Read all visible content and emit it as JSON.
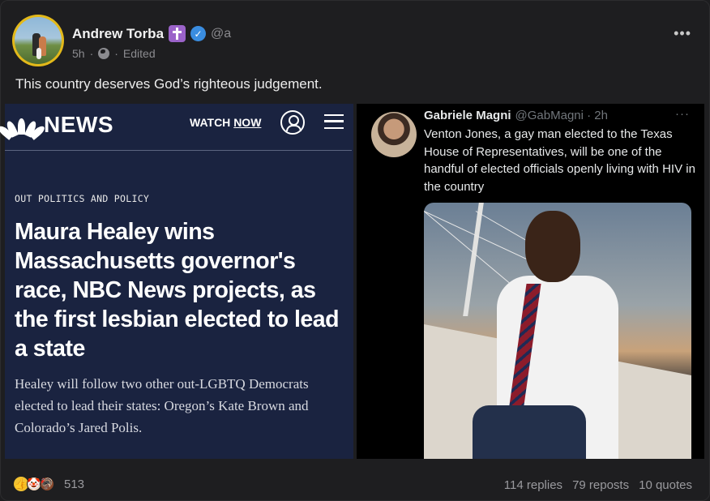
{
  "post": {
    "author_name": "Andrew Torba",
    "handle": "@a",
    "time": "5h",
    "edited": "Edited",
    "dot": "·",
    "more": "•••",
    "text": "This country deserves God’s righteous judgement."
  },
  "media": {
    "nbc": {
      "logo_text": "NEWS",
      "watch": "WATCH",
      "now": "NOW",
      "kicker": "OUT POLITICS AND POLICY",
      "headline": "Maura Healey wins Massachusetts governor's race, NBC News projects, as the first lesbian elected to lead a state",
      "dek": "Healey will follow two other out-LGBTQ Democrats elected to lead their states: Oregon’s Kate Brown and Colorado’s Jared Polis."
    },
    "tweet": {
      "name": "Gabriele Magni",
      "handle": "@GabMagni · 2h",
      "more": "···",
      "text": "Venton Jones, a gay man elected to the Texas House of Representatives, will be one of the handful of elected officials openly living with HIV in the country"
    }
  },
  "footer": {
    "reactions": [
      "thumbs-up",
      "clown",
      "turkey"
    ],
    "reaction_count": "513",
    "replies": "114 replies",
    "reposts": "79 reposts",
    "quotes": "10 quotes"
  },
  "colors": {
    "background": "#1e1e20",
    "nbc_navy": "#1a2340",
    "verified_blue": "#3a8de0",
    "avatar_ring": "#e3b91a",
    "cross_badge": "#9b63c9"
  }
}
